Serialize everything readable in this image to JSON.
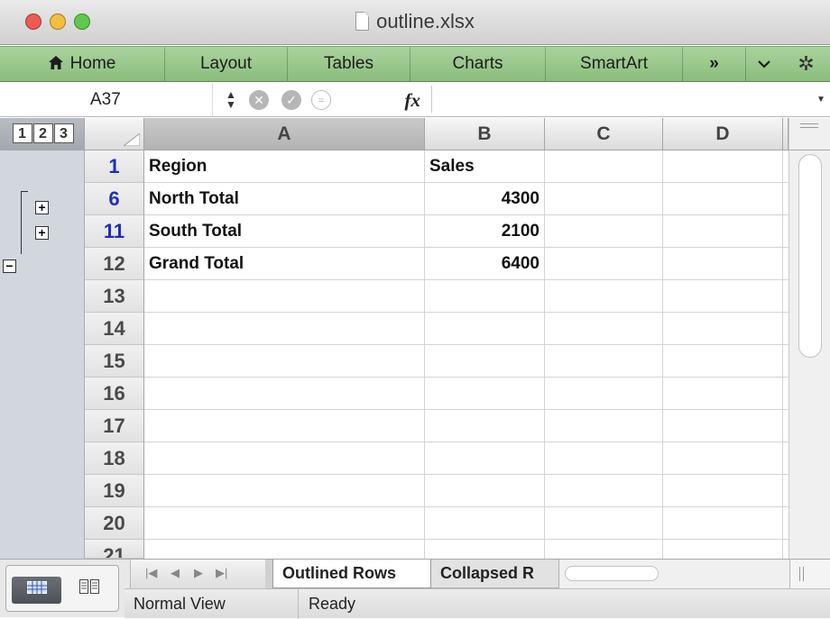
{
  "window": {
    "title": "outline.xlsx",
    "lights": {
      "close": "#ee5a52",
      "minimize": "#f4be3f",
      "zoom": "#5ec94c"
    }
  },
  "ribbon": {
    "home_icon": "house-icon",
    "tabs": [
      "Home",
      "Layout",
      "Tables",
      "Charts",
      "SmartArt"
    ],
    "overflow": "»"
  },
  "formula_bar": {
    "name_box": "A37",
    "fx": "fx",
    "value": ""
  },
  "outline_levels": [
    "1",
    "2",
    "3"
  ],
  "columns": [
    "A",
    "B",
    "C",
    "D"
  ],
  "rows": [
    {
      "num": "1",
      "a": "Region",
      "b": "Sales",
      "grouped": true
    },
    {
      "num": "6",
      "a": "North Total",
      "b": "4300",
      "grouped": true
    },
    {
      "num": "11",
      "a": "South Total",
      "b": "2100",
      "grouped": true
    },
    {
      "num": "12",
      "a": "Grand Total",
      "b": "6400",
      "grouped": false
    },
    {
      "num": "13"
    },
    {
      "num": "14"
    },
    {
      "num": "15"
    },
    {
      "num": "16"
    },
    {
      "num": "17"
    },
    {
      "num": "18"
    },
    {
      "num": "19"
    },
    {
      "num": "20"
    },
    {
      "num": "21"
    }
  ],
  "sheets": {
    "active": "Outlined Rows",
    "other": "Collapsed R"
  },
  "status": {
    "view": "Normal View",
    "state": "Ready"
  },
  "colors": {
    "ribbon": "#9cc98e",
    "group_row_number": "#1f2fb8",
    "gutter": "#d2d6dd"
  }
}
